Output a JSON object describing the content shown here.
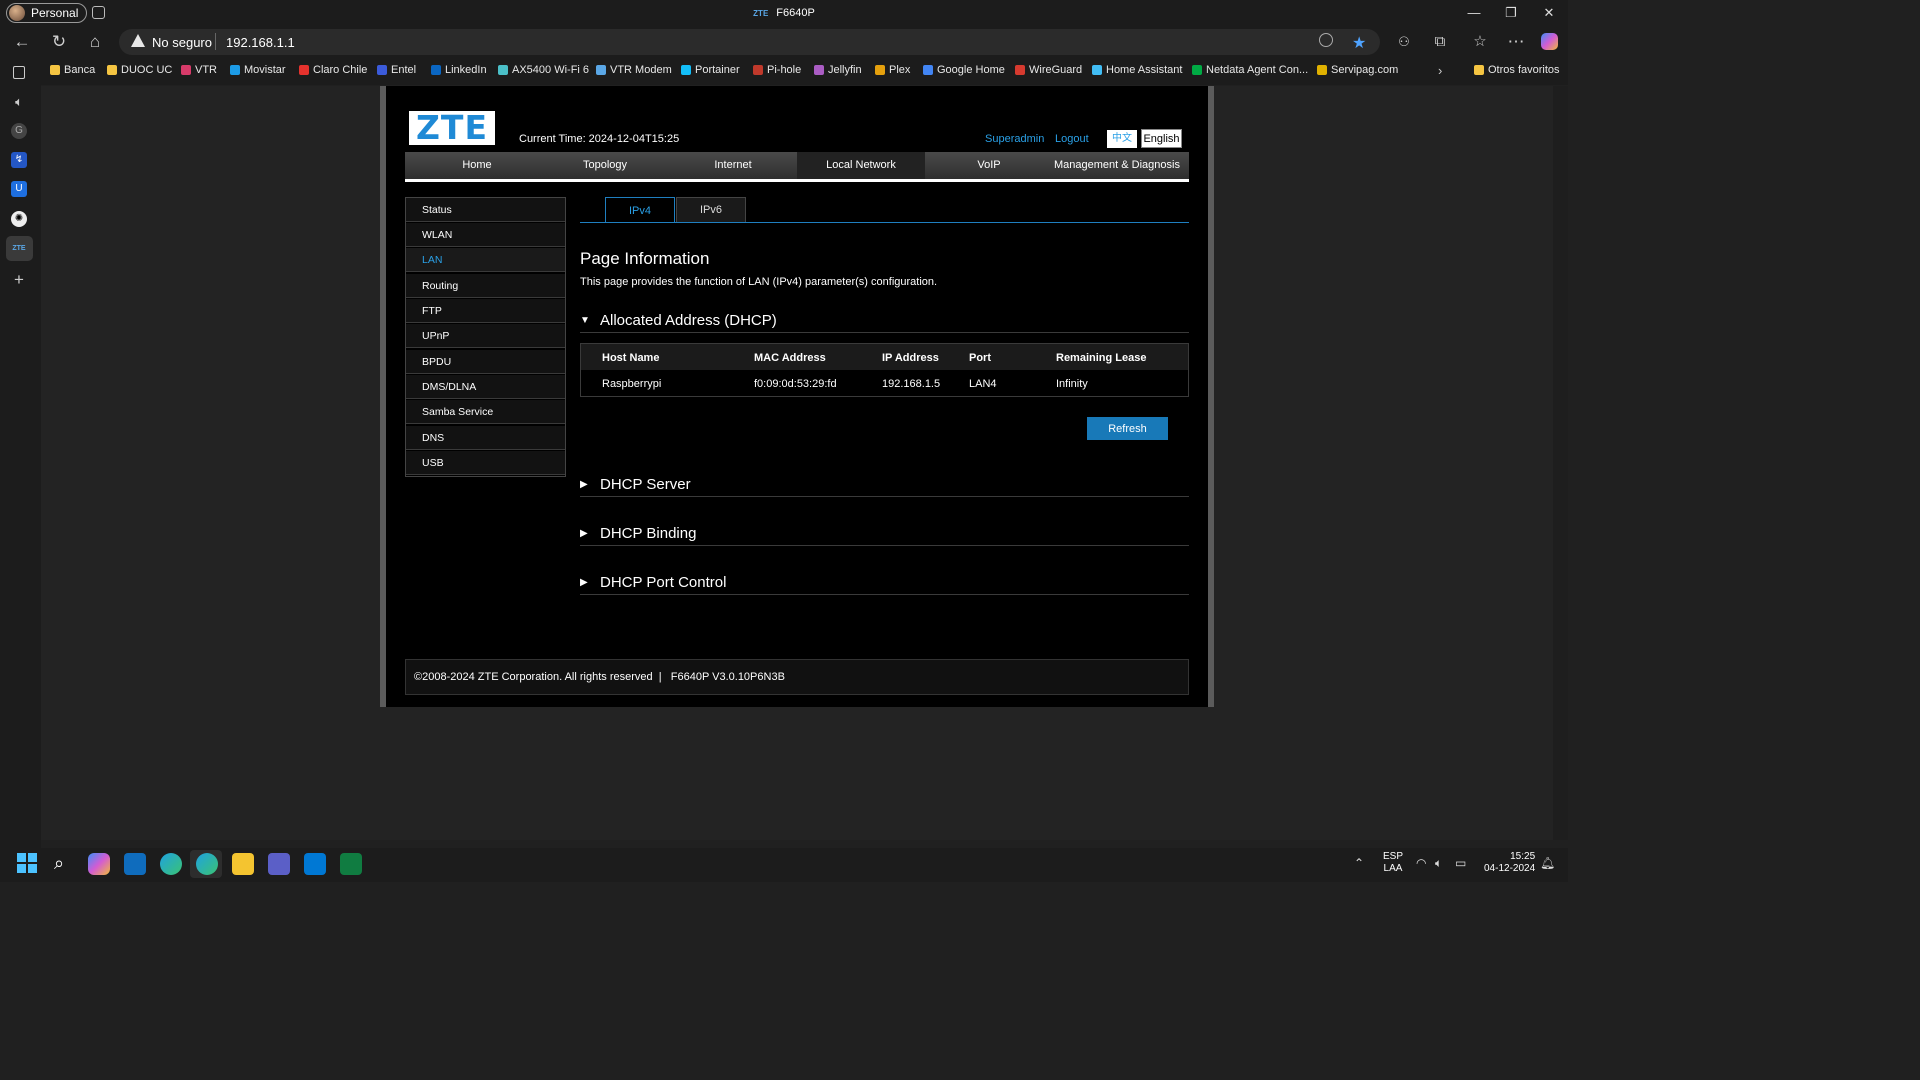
{
  "browser": {
    "profile_label": "Personal",
    "tab_title": "F6640P",
    "tab_brand": "ZTE",
    "security_label": "No seguro",
    "url": "192.168.1.1"
  },
  "bookmarks": [
    {
      "label": "Banca",
      "color": "#f5c542"
    },
    {
      "label": "DUOC UC",
      "color": "#f5c542"
    },
    {
      "label": "VTR",
      "color": "#d83b6a"
    },
    {
      "label": "Movistar",
      "color": "#1c9be6"
    },
    {
      "label": "Claro Chile",
      "color": "#e5322d"
    },
    {
      "label": "Entel",
      "color": "#3b5bdb"
    },
    {
      "label": "LinkedIn",
      "color": "#0a66c2"
    },
    {
      "label": "AX5400 Wi-Fi 6",
      "color": "#4bc0c8"
    },
    {
      "label": "VTR Modem",
      "color": "#5aa7e6"
    },
    {
      "label": "Portainer",
      "color": "#13bef9"
    },
    {
      "label": "Pi-hole",
      "color": "#c0392b"
    },
    {
      "label": "Jellyfin",
      "color": "#aa5cc3"
    },
    {
      "label": "Plex",
      "color": "#e5a00d"
    },
    {
      "label": "Google Home",
      "color": "#4285f4"
    },
    {
      "label": "WireGuard",
      "color": "#d63a2f"
    },
    {
      "label": "Home Assistant",
      "color": "#41bdf5"
    },
    {
      "label": "Netdata Agent Con...",
      "color": "#00ab44"
    },
    {
      "label": "Servipag.com",
      "color": "#e0b100"
    }
  ],
  "bookmarks_other": "Otros favoritos",
  "router": {
    "current_time_label": "Current Time: 2024-12-04T15:25",
    "user_label": "Superadmin",
    "logout_label": "Logout",
    "lang_zh": "中文",
    "lang_en": "English",
    "nav": [
      "Home",
      "Topology",
      "Internet",
      "Local Network",
      "VoIP",
      "Management & Diagnosis"
    ],
    "nav_active": "Local Network",
    "menu": [
      "Status",
      "WLAN",
      "LAN",
      "Routing",
      "FTP",
      "UPnP",
      "BPDU",
      "DMS/DLNA",
      "Samba Service",
      "DNS",
      "USB"
    ],
    "menu_active": "LAN",
    "tabs": [
      "IPv4",
      "IPv6"
    ],
    "page_title": "Page Information",
    "page_desc": "This page provides the function of LAN (IPv4) parameter(s) configuration.",
    "sections": [
      "Allocated Address (DHCP)",
      "DHCP Server",
      "DHCP Binding",
      "DHCP Port Control"
    ],
    "table_headers": [
      "Host Name",
      "MAC Address",
      "IP Address",
      "Port",
      "Remaining Lease"
    ],
    "table_rows": [
      [
        "Raspberrypi",
        "f0:09:0d:53:29:fd",
        "192.168.1.5",
        "LAN4",
        "Infinity"
      ]
    ],
    "refresh_label": "Refresh",
    "footer": "©2008-2024 ZTE Corporation. All rights reserved  |   F6640P V3.0.10P6N3B"
  },
  "taskbar": {
    "lang_top": "ESP",
    "lang_bottom": "LAA",
    "time": "15:25",
    "date": "04-12-2024"
  },
  "colors": {
    "accent": "#2aa0e6",
    "button": "#1879b8"
  }
}
